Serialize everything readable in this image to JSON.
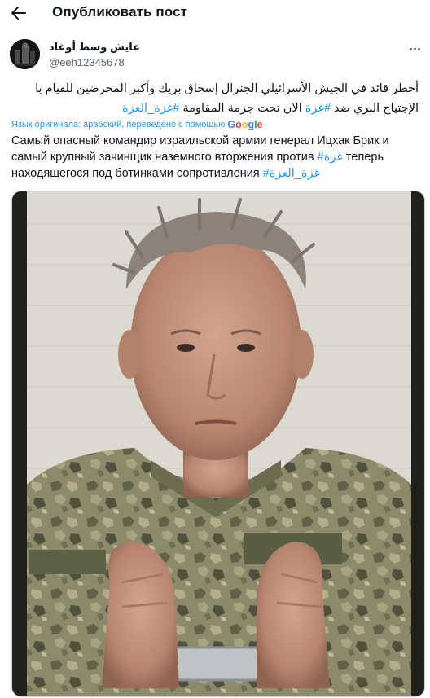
{
  "header": {
    "title": "Опубликовать пост",
    "back_icon": "arrow-left-icon"
  },
  "author": {
    "display_name": "عايش وسط أوغاد",
    "handle": "@eeh12345678"
  },
  "post": {
    "arabic_line1": "أخطر قائد في الجيش الأسرائيلي الجنرال إسحاق بريك وأكبر المحرضين للقيام با",
    "arabic_line2_text": "الإجتياح البري ضد ",
    "arabic_hashtag1": "#غزة",
    "arabic_line2_mid": " الان  تحت جزمة المقاومة  ",
    "arabic_hashtag2": "#غزة_العزة",
    "translation_note": "Язык оригинала: арабский, переведено с помощью",
    "translation_provider": "Google",
    "russian_text": "Самый опасный командир израильской армии генерал Ицхак Брик и самый крупный зачинщик наземного вторжения против ",
    "russian_hashtag1": "#غزة",
    "russian_text2": " теперь находящегося под ботинками сопротивления ",
    "russian_hashtag2": "#غزة_العزة"
  },
  "colors": {
    "accent": "#1d9bf0",
    "text": "#0f1419",
    "secondary": "#536471"
  }
}
